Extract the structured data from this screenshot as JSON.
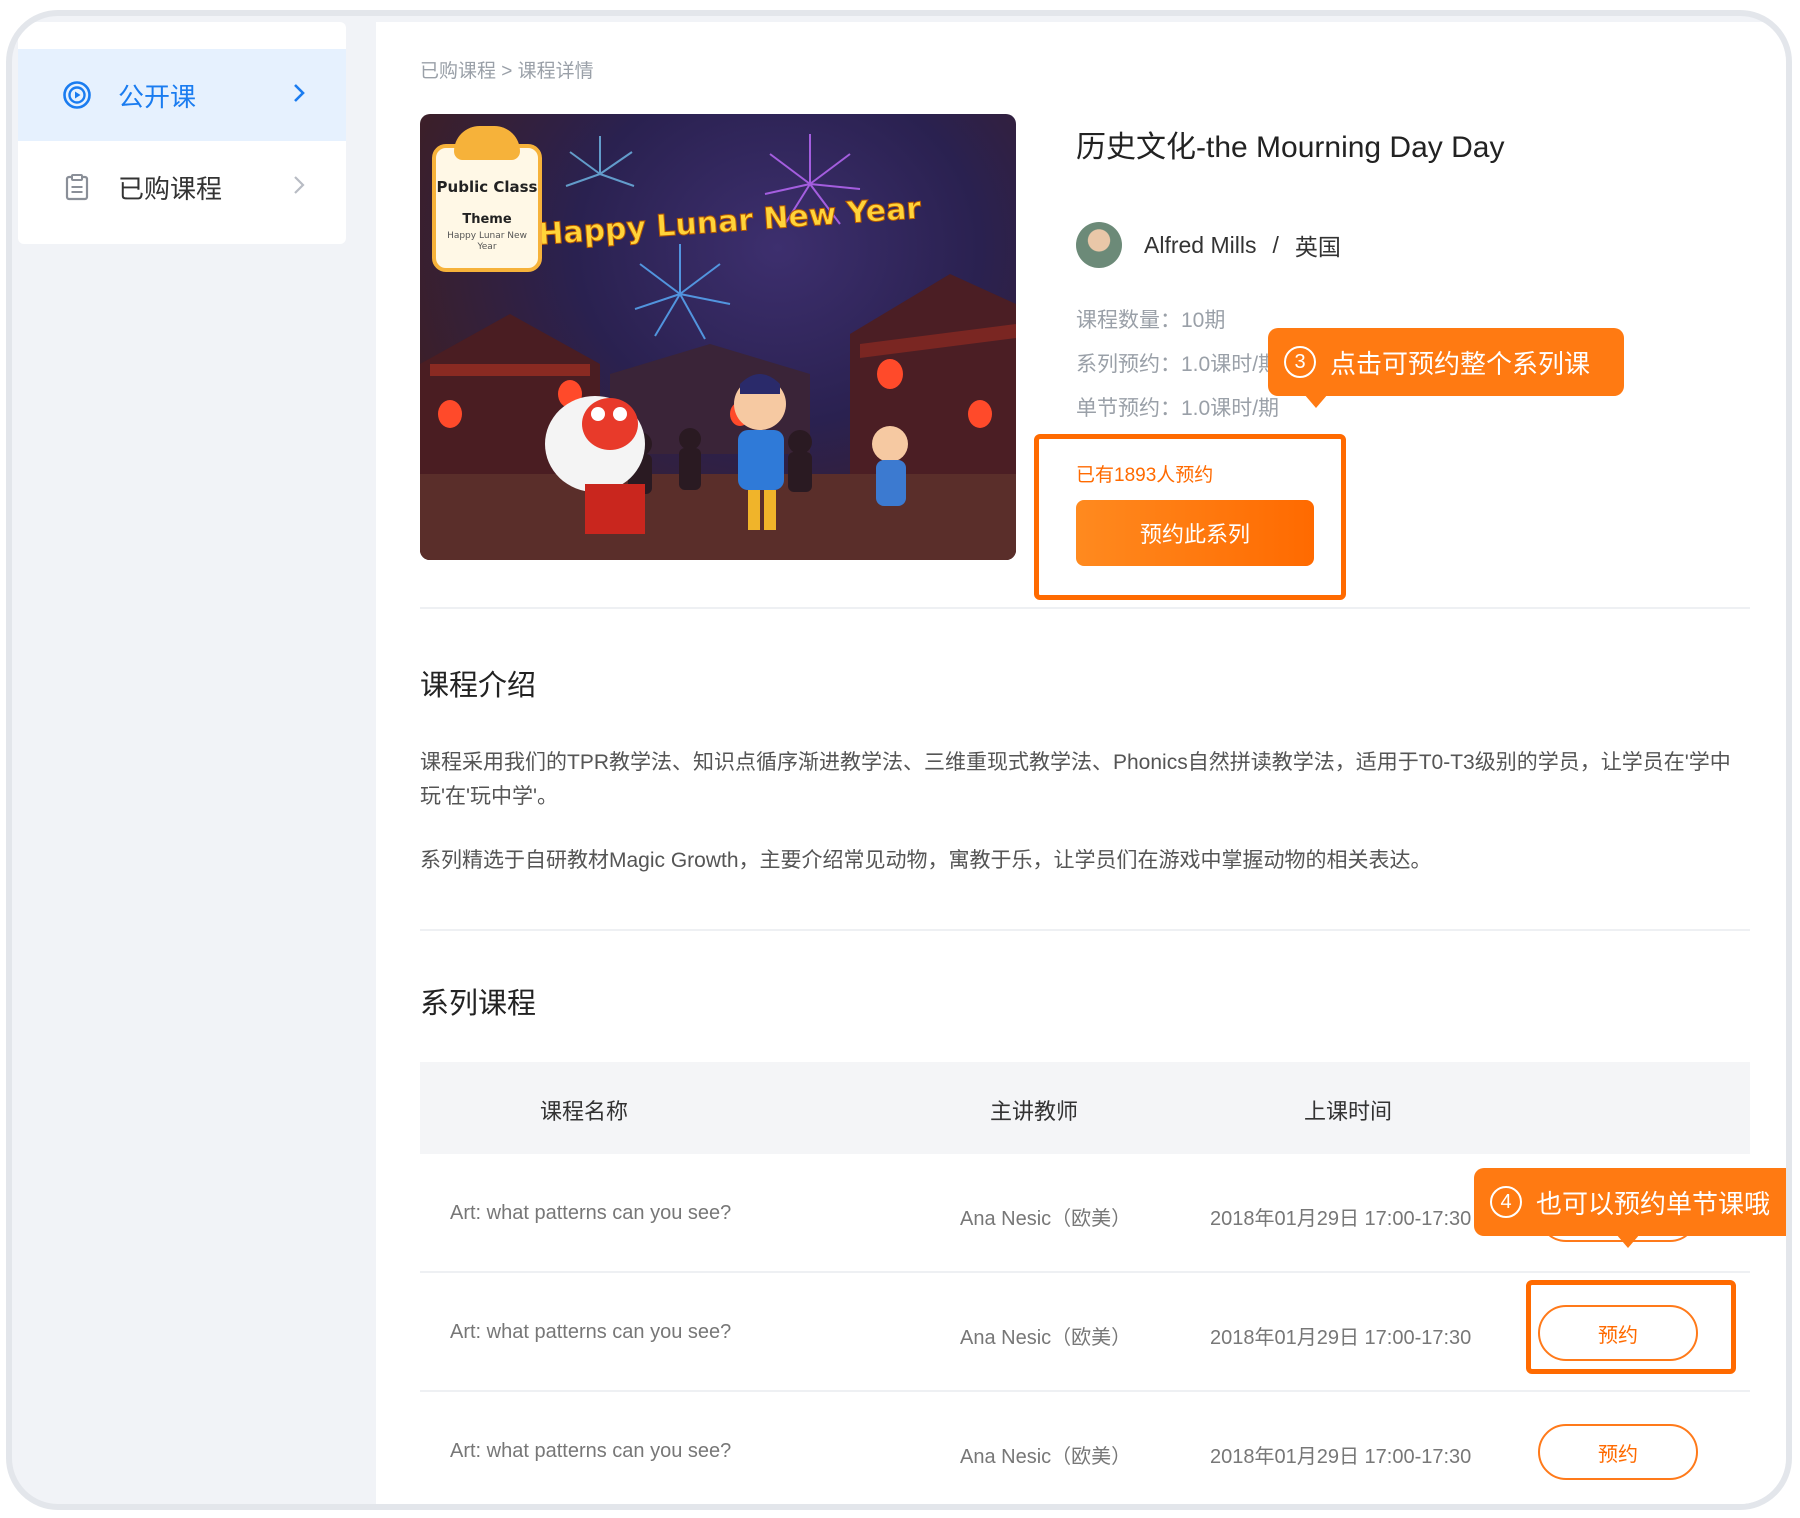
{
  "sidebar": {
    "items": [
      {
        "label": "公开课",
        "icon": "play-circle-icon",
        "active": true
      },
      {
        "label": "已购课程",
        "icon": "clipboard-icon",
        "active": false
      }
    ]
  },
  "breadcrumb": {
    "parent": "已购课程",
    "separator": " > ",
    "current": "课程详情"
  },
  "cover": {
    "badge_title": "Public Class",
    "badge_theme": "Theme",
    "badge_subtitle": "Happy Lunar New Year",
    "banner_text": "Happy Lunar New Year"
  },
  "course": {
    "title": "历史文化-the Mourning Day Day",
    "teacher_name": "Alfred Mills",
    "teacher_separator": "/",
    "teacher_country": "英国",
    "count_line": "课程数量：10期",
    "series_line": "系列预约：1.0课时/期",
    "single_line": "单节预约：1.0课时/期",
    "booked_text": "已有1893人预约",
    "book_series_label": "预约此系列"
  },
  "callouts": {
    "series": {
      "num": "3",
      "text": "点击可预约整个系列课"
    },
    "single": {
      "num": "4",
      "text": "也可以预约单节课哦"
    }
  },
  "intro": {
    "title": "课程介绍",
    "para1": "课程采用我们的TPR教学法、知识点循序渐进教学法、三维重现式教学法、Phonics自然拼读教学法，适用于T0-T3级别的学员，让学员在'学中玩'在'玩中学'。",
    "para2": "系列精选于自研教材Magic Growth，主要介绍常见动物，寓教于乐，让学员们在游戏中掌握动物的相关表达。"
  },
  "series": {
    "title": "系列课程",
    "columns": [
      "课程名称",
      "主讲教师",
      "上课时间"
    ],
    "rows": [
      {
        "name": "Art: what patterns can you see?",
        "teacher": "Ana Nesic（欧美）",
        "time": "2018年01月29日 17:00-17:30",
        "action": "预约"
      },
      {
        "name": "Art: what patterns can you see?",
        "teacher": "Ana Nesic（欧美）",
        "time": "2018年01月29日 17:00-17:30",
        "action": "预约"
      },
      {
        "name": "Art: what patterns can you see?",
        "teacher": "Ana Nesic（欧美）",
        "time": "2018年01月29日 17:00-17:30",
        "action": "预约"
      }
    ]
  },
  "colors": {
    "accent": "#ff6a00",
    "active": "#1a7cf0"
  }
}
